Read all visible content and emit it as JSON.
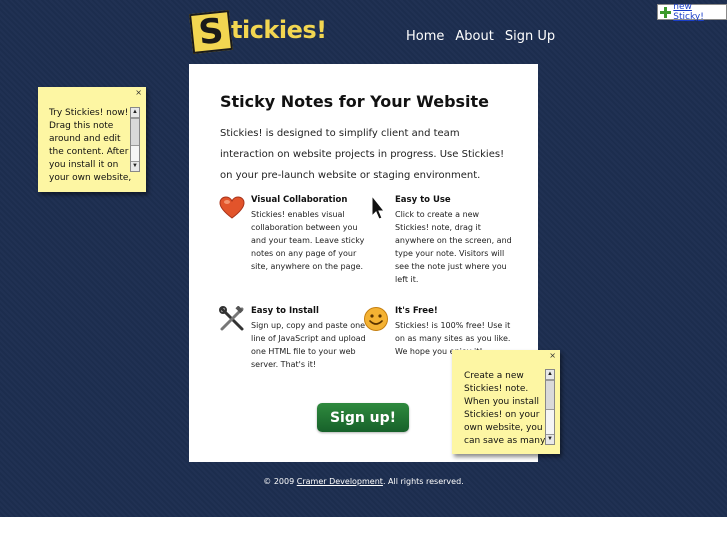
{
  "header": {
    "logo_letter": "S",
    "logo_word": "tickies!",
    "nav": [
      "Home",
      "About",
      "Sign Up"
    ],
    "new_sticky_label": "new Sticky!"
  },
  "main": {
    "title": "Sticky Notes for Your Website",
    "intro": "Stickies! is designed to simplify client and team interaction on website projects in progress. Use Stickies! on your pre-launch website or staging environment.",
    "features": [
      {
        "icon": "heart-icon",
        "title": "Visual Collaboration",
        "body": "Stickies! enables visual collaboration between you and your team. Leave sticky notes on any page of your site, anywhere on the page."
      },
      {
        "icon": "cursor-icon",
        "title": "Easy to Use",
        "body": "Click to create a new Stickies! note, drag it anywhere on the screen, and type your note. Visitors will see the note just where you left it."
      },
      {
        "icon": "tools-icon",
        "title": "Easy to Install",
        "body": "Sign up, copy and paste one line of JavaScript and upload one HTML file to your web server. That's it!"
      },
      {
        "icon": "smiley-icon",
        "title": "It's Free!",
        "body": "Stickies! is 100% free! Use it on as many sites as you like. We hope you enjoy it!"
      }
    ],
    "signup_label": "Sign up!"
  },
  "footer": {
    "prefix": "© 2009 ",
    "link": "Cramer Development",
    "suffix": ". All rights reserved."
  },
  "stickies": [
    {
      "close": "×",
      "text": "Try Stickies! now!\nDrag this note\naround and edit\nthe content. After\nyou install it on\nyour own website,"
    },
    {
      "close": "×",
      "text": "Create a new\nStickies! note.\nWhen you install\nStickies! on your\nown website, you\ncan save as many"
    }
  ],
  "colors": {
    "background": "#1d2e50",
    "sticky": "#fdf6a3",
    "logo_yellow": "#f2d651",
    "signup_green": "#2f8a3e"
  }
}
